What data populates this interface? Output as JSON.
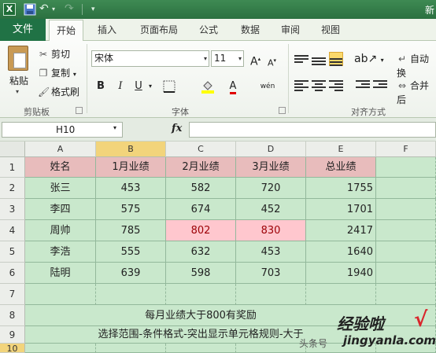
{
  "titlebar": {
    "title": "新"
  },
  "tabs": {
    "file": "文件",
    "items": [
      "开始",
      "插入",
      "页面布局",
      "公式",
      "数据",
      "审阅",
      "视图"
    ],
    "active": "开始"
  },
  "ribbon": {
    "clipboard": {
      "paste": "粘贴",
      "cut": "剪切",
      "copy": "复制",
      "format_painter": "格式刷",
      "group": "剪贴板"
    },
    "font": {
      "name": "宋体",
      "size": "11",
      "grow": "A",
      "shrink": "A",
      "bold": "B",
      "italic": "I",
      "underline": "U",
      "color": "A",
      "phonetic_icon": "wén",
      "group": "字体"
    },
    "alignment": {
      "wrap": "自动换",
      "merge": "合并后",
      "group": "对齐方式"
    }
  },
  "formula_bar": {
    "name_box": "H10",
    "fx": "fx",
    "value": ""
  },
  "grid": {
    "columns": [
      "A",
      "B",
      "C",
      "D",
      "E",
      "F"
    ],
    "rows": [
      "1",
      "2",
      "3",
      "4",
      "5",
      "6",
      "7",
      "8",
      "9",
      "10"
    ],
    "header": [
      "姓名",
      "1月业绩",
      "2月业绩",
      "3月业绩",
      "总业绩"
    ],
    "data": [
      [
        "张三",
        "453",
        "582",
        "720",
        "1755"
      ],
      [
        "李四",
        "575",
        "674",
        "452",
        "1701"
      ],
      [
        "周帅",
        "785",
        "802",
        "830",
        "2417"
      ],
      [
        "李浩",
        "555",
        "632",
        "453",
        "1640"
      ],
      [
        "陆明",
        "639",
        "598",
        "703",
        "1940"
      ]
    ],
    "note1": "每月业绩大于800有奖励",
    "note2": "选择范围-条件格式-突出显示单元格规则-大于",
    "highlight_color": "#ffc7ce",
    "fill_color": "#c9e8cc",
    "header_fill": "#e8bcbc"
  },
  "watermark": {
    "cn": "经验啦",
    "check": "√",
    "src": "头条号",
    "url": "jingyanla.com"
  }
}
